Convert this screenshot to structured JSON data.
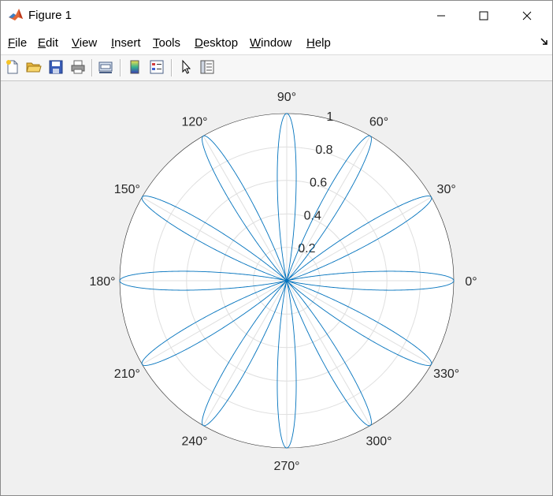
{
  "window": {
    "title": "Figure 1",
    "controls": [
      "minimize",
      "maximize",
      "close"
    ]
  },
  "menubar": {
    "items": [
      {
        "label": "File",
        "mnemonic": "F",
        "rest": "ile"
      },
      {
        "label": "Edit",
        "mnemonic": "E",
        "rest": "dit"
      },
      {
        "label": "View",
        "mnemonic": "V",
        "rest": "iew"
      },
      {
        "label": "Insert",
        "mnemonic": "I",
        "rest": "nsert"
      },
      {
        "label": "Tools",
        "mnemonic": "T",
        "rest": "ools"
      },
      {
        "label": "Desktop",
        "mnemonic": "D",
        "rest": "esktop"
      },
      {
        "label": "Window",
        "mnemonic": "W",
        "rest": "indow"
      },
      {
        "label": "Help",
        "mnemonic": "H",
        "rest": "elp"
      }
    ]
  },
  "toolbar": {
    "buttons": [
      "new-figure-icon",
      "open-file-icon",
      "save-icon",
      "print-icon",
      "link-plot-icon",
      "colorbar-icon",
      "legend-icon",
      "edit-plot-icon",
      "property-inspector-icon"
    ]
  },
  "chart_data": {
    "type": "polar-line",
    "function": "r = |cos(6*theta)|^3",
    "series": [
      {
        "r_expression": "abs(cos(6*theta))^3",
        "theta_range_deg": [
          0,
          360
        ],
        "color": "#0072bd"
      }
    ],
    "theta_tick_labels": [
      "0°",
      "30°",
      "60°",
      "90°",
      "120°",
      "150°",
      "180°",
      "210°",
      "240°",
      "270°",
      "300°",
      "330°"
    ],
    "theta_ticks_deg": [
      0,
      30,
      60,
      90,
      120,
      150,
      180,
      210,
      240,
      270,
      300,
      330
    ],
    "r_tick_labels": [
      "0.2",
      "0.4",
      "0.6",
      "0.8",
      "1"
    ],
    "r_ticks": [
      0.2,
      0.4,
      0.6,
      0.8,
      1
    ],
    "rlim": [
      0,
      1
    ],
    "grid": true
  }
}
